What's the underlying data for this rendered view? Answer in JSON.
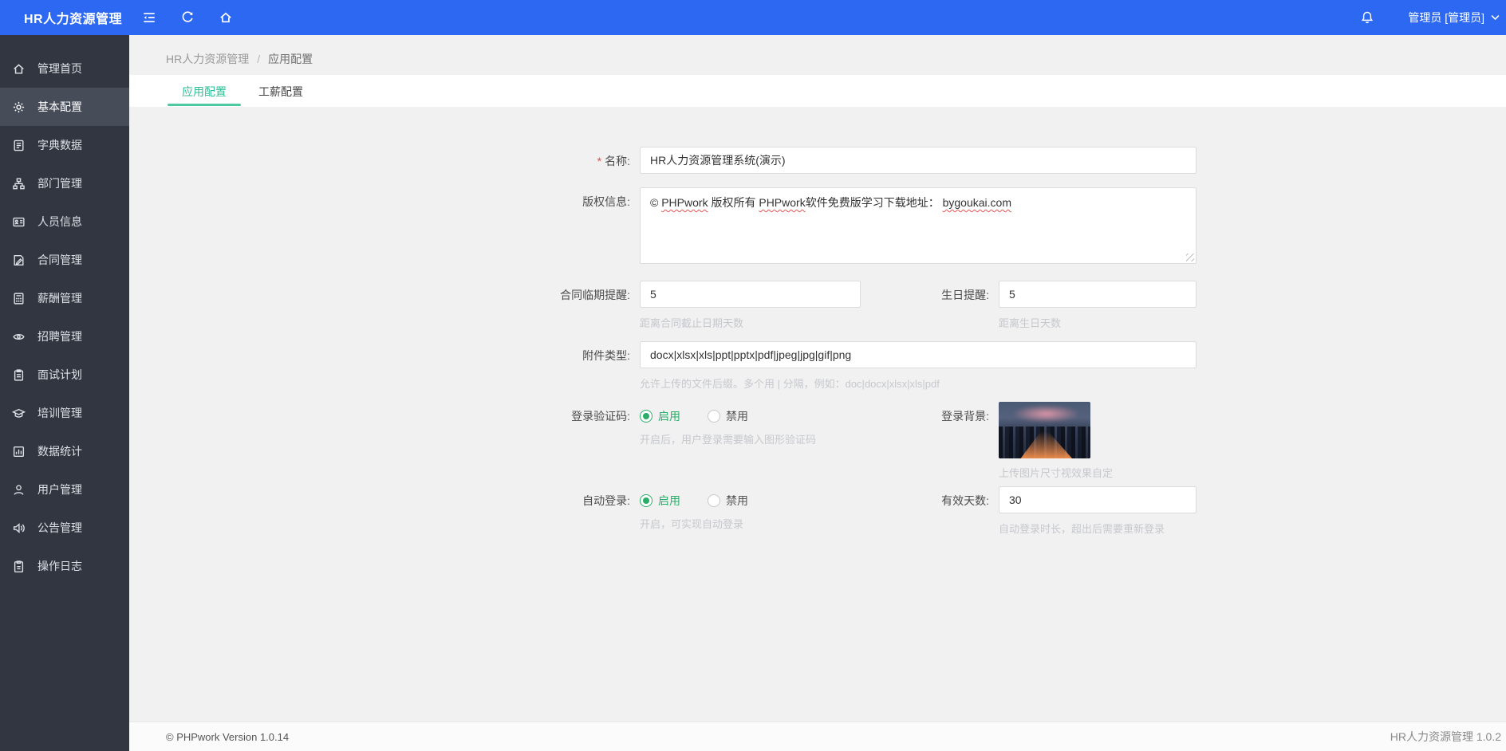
{
  "header": {
    "title": "HR人力资源管理",
    "user": "管理员 [管理员]"
  },
  "breadcrumb": {
    "root": "HR人力资源管理",
    "separator": "/",
    "current": "应用配置"
  },
  "tabs": [
    {
      "label": "应用配置",
      "active": true
    },
    {
      "label": "工薪配置",
      "active": false
    }
  ],
  "sidebar": {
    "items": [
      {
        "label": "管理首页",
        "icon": "home-icon",
        "active": false
      },
      {
        "label": "基本配置",
        "icon": "gear-icon",
        "active": true
      },
      {
        "label": "字典数据",
        "icon": "dictionary-icon",
        "active": false
      },
      {
        "label": "部门管理",
        "icon": "org-chart-icon",
        "active": false
      },
      {
        "label": "人员信息",
        "icon": "id-card-icon",
        "active": false
      },
      {
        "label": "合同管理",
        "icon": "contract-pen-icon",
        "active": false
      },
      {
        "label": "薪酬管理",
        "icon": "calculator-icon",
        "active": false
      },
      {
        "label": "招聘管理",
        "icon": "eye-icon",
        "active": false
      },
      {
        "label": "面试计划",
        "icon": "clipboard-icon",
        "active": false
      },
      {
        "label": "培训管理",
        "icon": "graduation-cap-icon",
        "active": false
      },
      {
        "label": "数据统计",
        "icon": "bar-chart-icon",
        "active": false
      },
      {
        "label": "用户管理",
        "icon": "user-icon",
        "active": false
      },
      {
        "label": "公告管理",
        "icon": "speaker-icon",
        "active": false
      },
      {
        "label": "操作日志",
        "icon": "log-icon",
        "active": false
      }
    ]
  },
  "form": {
    "name": {
      "label": "名称:",
      "required_mark": "*",
      "value": "HR人力资源管理系统(演示)"
    },
    "copyright": {
      "label": "版权信息:",
      "segments": [
        {
          "text": "© "
        },
        {
          "text": "PHPwork",
          "misspelled": true
        },
        {
          "text": " 版权所有 "
        },
        {
          "text": "PHPwork",
          "misspelled": true
        },
        {
          "text": "软件免费版学习下载地址： "
        },
        {
          "text": "bygoukai.com",
          "misspelled": true
        }
      ]
    },
    "contract_reminder": {
      "label": "合同临期提醒:",
      "value": "5",
      "hint": "距离合同截止日期天数"
    },
    "birthday_reminder": {
      "label": "生日提醒:",
      "value": "5",
      "hint": "距离生日天数"
    },
    "attachment_types": {
      "label": "附件类型:",
      "value": "docx|xlsx|xls|ppt|pptx|pdf|jpeg|jpg|gif|png",
      "hint": "允许上传的文件后缀。多个用 | 分隔，例如：doc|docx|xlsx|xls|pdf"
    },
    "login_captcha": {
      "label": "登录验证码:",
      "options": [
        "启用",
        "禁用"
      ],
      "selected": "启用",
      "hint": "开启后，用户登录需要输入图形验证码"
    },
    "login_background": {
      "label": "登录背景:",
      "caption": "上传图片尺寸视效果自定"
    },
    "auto_login": {
      "label": "自动登录:",
      "options": [
        "启用",
        "禁用"
      ],
      "selected": "启用",
      "hint": "开启，可实现自动登录"
    },
    "valid_days": {
      "label": "有效天数:",
      "value": "30",
      "hint": "自动登录时长，超出后需要重新登录"
    }
  },
  "footer": {
    "left": "© PHPwork Version 1.0.14",
    "right": "HR人力资源管理 1.0.2"
  },
  "colors": {
    "header_blue": "#2c68f2",
    "sidebar_dark": "#313640",
    "sidebar_active": "#464c58",
    "tab_green": "#2dbd96",
    "radio_green": "#2aad68",
    "required_red": "#e04b4b"
  }
}
